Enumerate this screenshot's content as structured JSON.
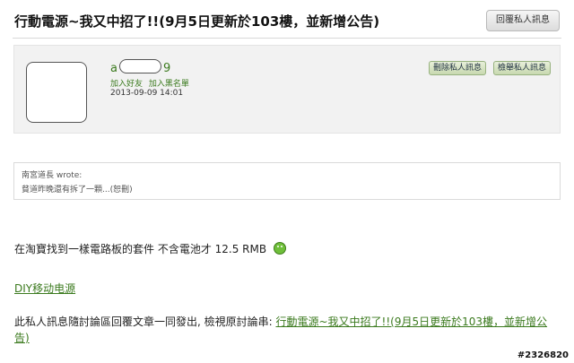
{
  "title": "行動電源~我又中招了!!(9月5日更新於103樓，並新增公告)",
  "reply_button": "回覆私人訊息",
  "profile": {
    "username_prefix": "a",
    "username_suffix": "9",
    "add_friend": "加入好友",
    "add_blacklist": "加入黑名單",
    "date": "2013-09-09 14:01",
    "delete_button": "刪除私人訊息",
    "report_button": "檢舉私人訊息"
  },
  "quote": {
    "author": "南宮道長 wrote:",
    "text": "貧道昨晚還有拆了一顆...(恕刪)"
  },
  "body": {
    "line1": "在淘寶找到一樣電路板的套件 不含電池才 12.5 RMB",
    "link1": "DIY移动电源",
    "line2_prefix": "此私人訊息隨討論區回覆文章一同發出, 檢視原討論串: ",
    "line2_link": "行動電源~我又中招了!!(9月5日更新於103樓，並新增公告)"
  },
  "watermark": "#2326820",
  "colors": {
    "link": "#3b7a1e",
    "profile_bg": "#f2f2f2"
  }
}
